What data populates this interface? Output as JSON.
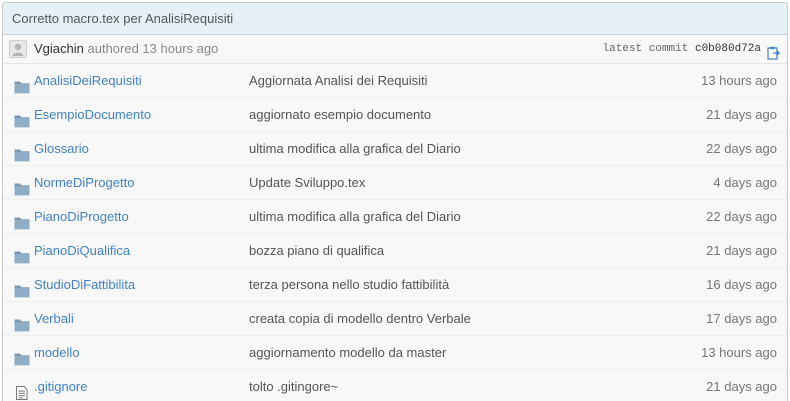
{
  "commit": {
    "title": "Corretto macro.tex per AnalisiRequisiti",
    "author": "Vgiachin",
    "authored_text": "authored 13 hours ago",
    "latest_label": "latest commit",
    "sha": "c0b080d72a"
  },
  "colors": {
    "link": "#4183c4",
    "header_bg": "#e6f1f6",
    "folder_icon": "#7c9ab5"
  },
  "files": [
    {
      "name": "AnalisiDeiRequisiti",
      "type": "folder",
      "icon": "folder-icon",
      "message": "Aggiornata Analisi dei Requisiti",
      "age": "13 hours ago"
    },
    {
      "name": "EsempioDocumento",
      "type": "folder",
      "icon": "folder-icon",
      "message": "aggiornato esempio documento",
      "age": "21 days ago"
    },
    {
      "name": "Glossario",
      "type": "folder",
      "icon": "folder-icon",
      "message": "ultima modifica alla grafica del Diario",
      "age": "22 days ago"
    },
    {
      "name": "NormeDiProgetto",
      "type": "folder",
      "icon": "folder-icon",
      "message": "Update Sviluppo.tex",
      "age": "4 days ago"
    },
    {
      "name": "PianoDiProgetto",
      "type": "folder",
      "icon": "folder-icon",
      "message": "ultima modifica alla grafica del Diario",
      "age": "22 days ago"
    },
    {
      "name": "PianoDiQualifica",
      "type": "folder",
      "icon": "folder-icon",
      "message": "bozza piano di qualifica",
      "age": "21 days ago"
    },
    {
      "name": "StudioDiFattibilita",
      "type": "folder",
      "icon": "folder-icon",
      "message": "terza persona nello studio fattibilità",
      "age": "16 days ago"
    },
    {
      "name": "Verbali",
      "type": "folder",
      "icon": "folder-icon",
      "message": "creata copia di modello dentro Verbale",
      "age": "17 days ago"
    },
    {
      "name": "modello",
      "type": "folder",
      "icon": "folder-icon",
      "message": "aggiornamento modello da master",
      "age": "13 hours ago"
    },
    {
      "name": ".gitignore",
      "type": "file",
      "icon": "file-icon",
      "message": "tolto .gitingore~",
      "age": "21 days ago"
    }
  ]
}
